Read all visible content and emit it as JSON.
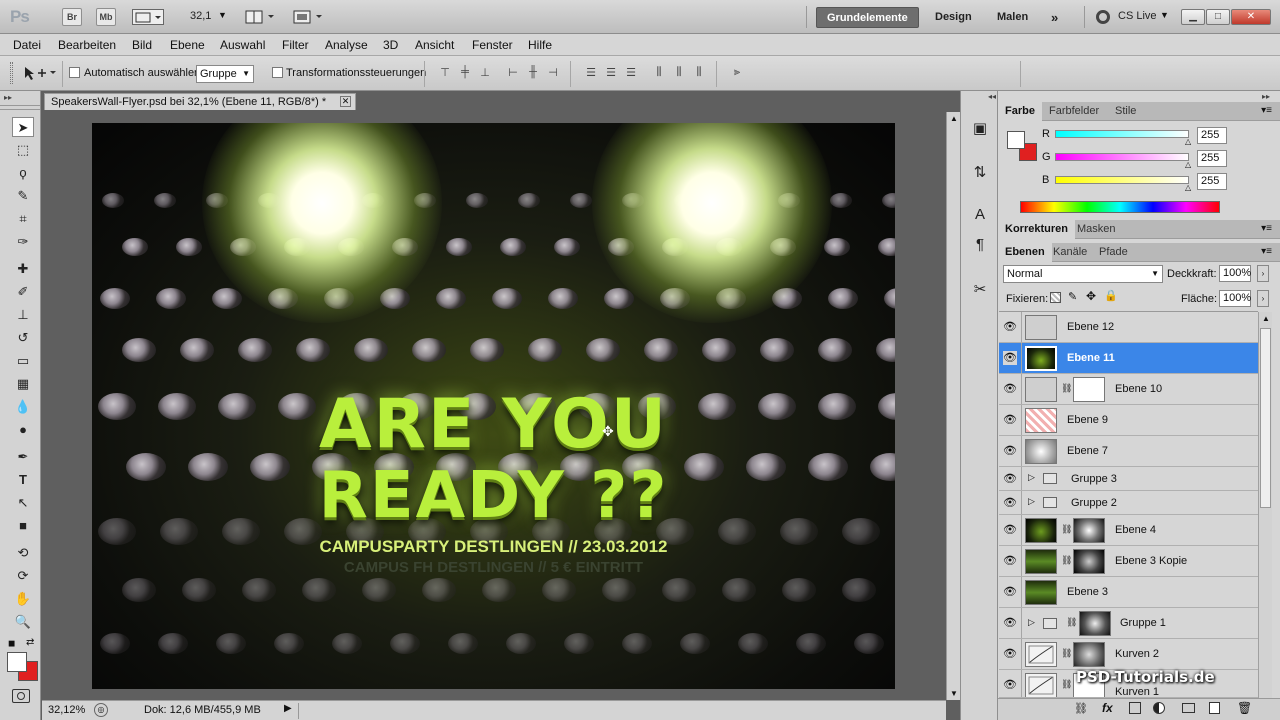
{
  "appbar": {
    "logo": "Ps",
    "bridge": "Br",
    "minibridge": "Mb",
    "zoom": "32,1",
    "workspaces": [
      "Grundelemente",
      "Design",
      "Malen"
    ],
    "more": "»",
    "cslive": "CS Live"
  },
  "menu": [
    "Datei",
    "Bearbeiten",
    "Bild",
    "Ebene",
    "Auswahl",
    "Filter",
    "Analyse",
    "3D",
    "Ansicht",
    "Fenster",
    "Hilfe"
  ],
  "options": {
    "auto_select_label": "Automatisch auswählen:",
    "auto_select_value": "Gruppe",
    "transform_label": "Transformationssteuerungen"
  },
  "document": {
    "tab_title": "SpeakersWall-Flyer.psd bei 32,1% (Ebene 11, RGB/8*) *",
    "flyer": {
      "line1": "ARE YOU",
      "line2": "READY ??",
      "line3": "CAMPUSPARTY DESTLINGEN // 23.03.2012",
      "line4": "CAMPUS FH DESTLINGEN  //  5 € EINTRITT"
    },
    "status_zoom": "32,12%",
    "status_doc": "Dok: 12,6 MB/455,9 MB"
  },
  "color_panel": {
    "tabs": [
      "Farbe",
      "Farbfelder",
      "Stile"
    ],
    "channels": [
      {
        "label": "R",
        "value": "255"
      },
      {
        "label": "G",
        "value": "255"
      },
      {
        "label": "B",
        "value": "255"
      }
    ]
  },
  "adjust_panel": {
    "tabs": [
      "Korrekturen",
      "Masken"
    ]
  },
  "layers_panel": {
    "tabs": [
      "Ebenen",
      "Kanäle",
      "Pfade"
    ],
    "blend_mode": "Normal",
    "opacity_label": "Deckkraft:",
    "opacity_value": "100%",
    "lock_label": "Fixieren:",
    "fill_label": "Fläche:",
    "fill_value": "100%",
    "layers": [
      {
        "name": "Ebene 12",
        "selected": false
      },
      {
        "name": "Ebene 11",
        "selected": true
      },
      {
        "name": "Ebene 10",
        "selected": false
      },
      {
        "name": "Ebene 9",
        "selected": false
      },
      {
        "name": "Ebene 7",
        "selected": false
      },
      {
        "name": "Gruppe 3",
        "selected": false
      },
      {
        "name": "Gruppe 2",
        "selected": false
      },
      {
        "name": "Ebene 4",
        "selected": false
      },
      {
        "name": "Ebene 3 Kopie",
        "selected": false
      },
      {
        "name": "Ebene 3",
        "selected": false
      },
      {
        "name": "Gruppe 1",
        "selected": false
      },
      {
        "name": "Kurven 2",
        "selected": false
      },
      {
        "name": "Kurven 1",
        "selected": false
      }
    ],
    "watermark": "PSD-Tutorials.de"
  },
  "colors": {
    "accent_selected": "#3b86e8",
    "flyer_green": "#b9ef3c",
    "foreground": "#ffffff",
    "background": "#e02020"
  }
}
